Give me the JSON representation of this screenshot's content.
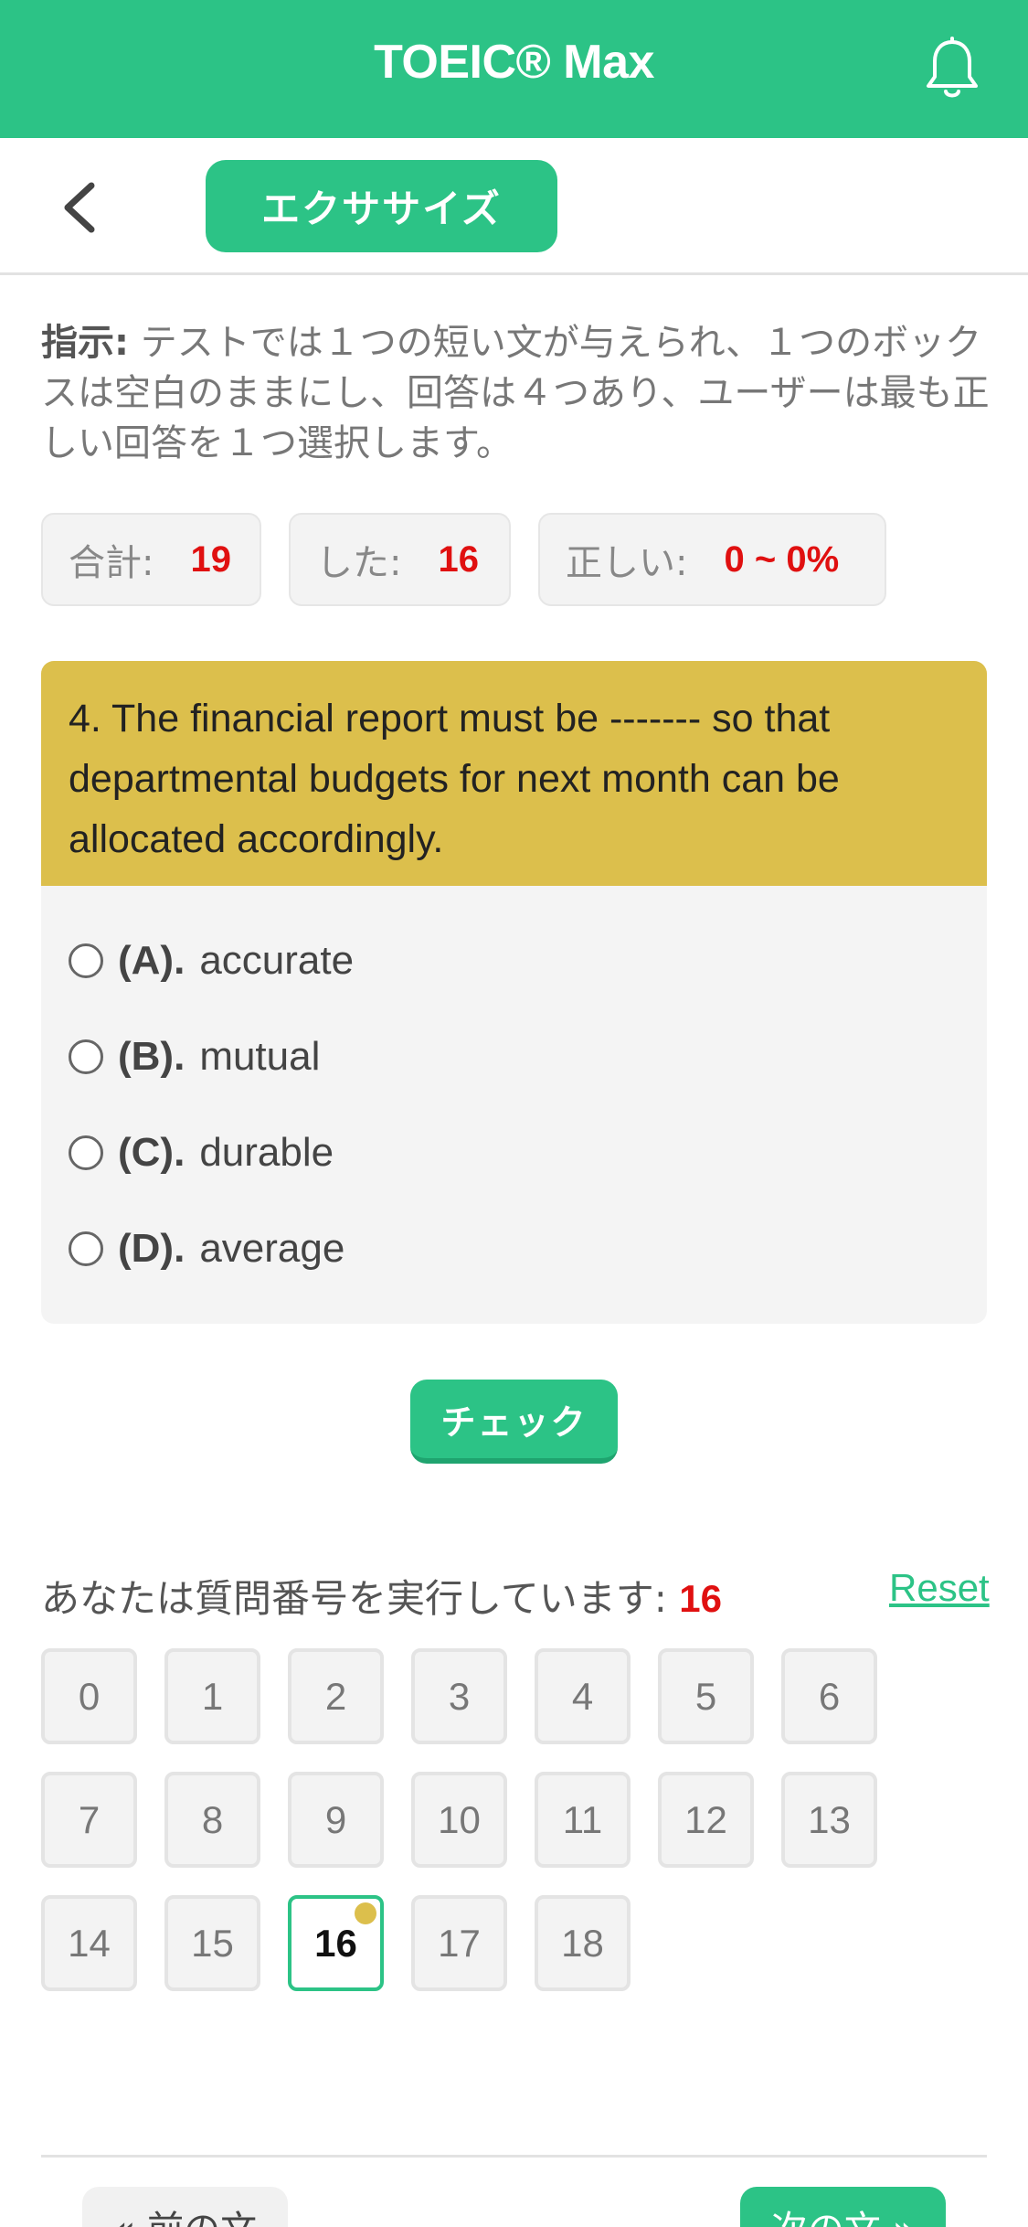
{
  "header": {
    "title": "TOEIC® Max",
    "bell_icon": "bell-icon"
  },
  "subbar": {
    "back_icon": "chevron-left-icon",
    "mode_label": "エクササイズ"
  },
  "instructions": {
    "label": "指示:",
    "text": " テストでは１つの短い文が与えられ、１つのボックスは空白のままにし、回答は４つあり、ユーザーは最も正しい回答を１つ選択します。"
  },
  "stats": {
    "total_label": "合計:",
    "total_value": "19",
    "done_label": "した:",
    "done_value": "16",
    "correct_label": "正しい:",
    "correct_value": "0 ~ 0%"
  },
  "question": {
    "text": "4. The financial report must be ------- so that departmental budgets for next month can be allocated accordingly.",
    "options": [
      {
        "key": "(A).",
        "text": "accurate"
      },
      {
        "key": "(B).",
        "text": "mutual"
      },
      {
        "key": "(C).",
        "text": "durable"
      },
      {
        "key": "(D).",
        "text": "average"
      }
    ]
  },
  "check_label": "チェック",
  "progress": {
    "running_label": "あなたは質問番号を実行しています:",
    "current": "16",
    "reset_label": "Reset",
    "numbers": [
      "0",
      "1",
      "2",
      "3",
      "4",
      "5",
      "6",
      "7",
      "8",
      "9",
      "10",
      "11",
      "12",
      "13",
      "14",
      "15",
      "16",
      "17",
      "18"
    ]
  },
  "footer": {
    "prev_label": "« 前の文",
    "next_label": "次の文 »"
  },
  "colors": {
    "accent": "#2cc386",
    "question_bg": "#dcbf4c",
    "highlight": "#e01010"
  }
}
